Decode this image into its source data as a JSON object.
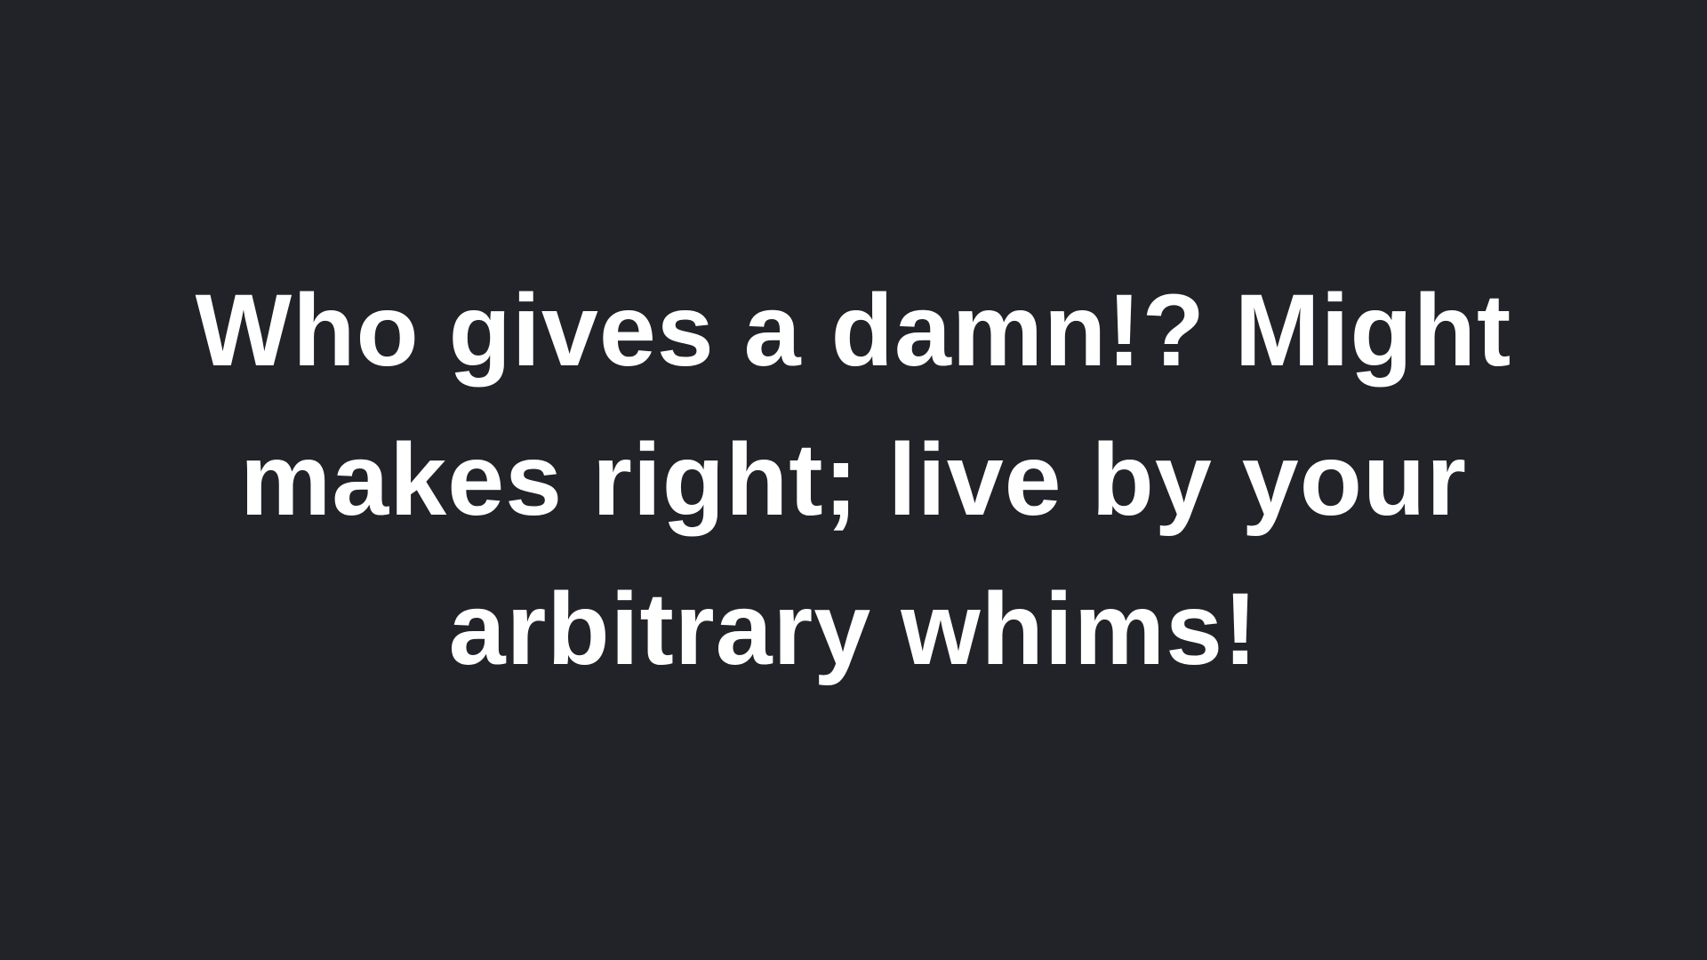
{
  "slide": {
    "lines": [
      "Who gives a damn!? Might",
      "makes right; live by your",
      "arbitrary whims!"
    ],
    "background_color": "#222328",
    "text_color": "#ffffff"
  }
}
